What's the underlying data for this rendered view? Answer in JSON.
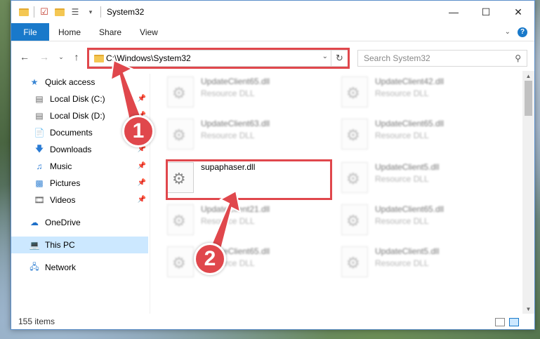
{
  "window": {
    "title": "System32"
  },
  "ribbon": {
    "file": "File",
    "home": "Home",
    "share": "Share",
    "view": "View"
  },
  "address": {
    "path": "C:\\Windows\\System32"
  },
  "search": {
    "placeholder": "Search System32"
  },
  "sidebar": {
    "items": [
      {
        "label": "Quick access"
      },
      {
        "label": "Local Disk (C:)"
      },
      {
        "label": "Local Disk (D:)"
      },
      {
        "label": "Documents"
      },
      {
        "label": "Downloads"
      },
      {
        "label": "Music"
      },
      {
        "label": "Pictures"
      },
      {
        "label": "Videos"
      },
      {
        "label": "OneDrive"
      },
      {
        "label": "This PC"
      },
      {
        "label": "Network"
      }
    ]
  },
  "files": [
    {
      "name": "UpdateClient65.dll",
      "type": "Resource DLL"
    },
    {
      "name": "UpdateClient42.dll",
      "type": "Resource DLL"
    },
    {
      "name": "UpdateClient63.dll",
      "type": "Resource DLL"
    },
    {
      "name": "UpdateClient65.dll",
      "type": "Resource DLL"
    },
    {
      "name": "supaphaser.dll",
      "type": ""
    },
    {
      "name": "UpdateClient5.dll",
      "type": "Resource DLL"
    },
    {
      "name": "UpdateClient21.dll",
      "type": "Resource DLL"
    },
    {
      "name": "UpdateClient65.dll",
      "type": "Resource DLL"
    },
    {
      "name": "UpdateClient65.dll",
      "type": "Resource DLL"
    },
    {
      "name": "UpdateClient5.dll",
      "type": "Resource DLL"
    }
  ],
  "status": {
    "count": "155 items"
  },
  "annotations": {
    "step1": "1",
    "step2": "2",
    "color": "#e0474c"
  }
}
